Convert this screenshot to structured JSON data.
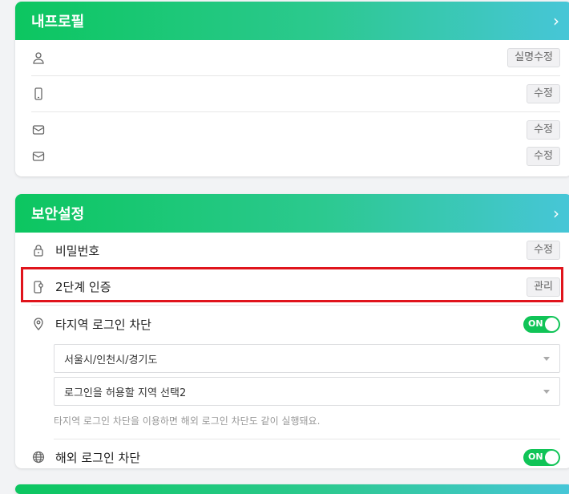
{
  "profile": {
    "title": "내프로필",
    "rows": [
      {
        "icon": "user-icon",
        "button": "실명수정"
      },
      {
        "icon": "phone-icon",
        "button": "수정"
      },
      {
        "icon": "mail-icon",
        "button": "수정"
      },
      {
        "icon": "mail-icon",
        "button": "수정"
      }
    ]
  },
  "security": {
    "title": "보안설정",
    "password": {
      "label": "비밀번호",
      "button": "수정"
    },
    "two_factor": {
      "label": "2단계 인증",
      "button": "관리"
    },
    "region_block": {
      "label": "타지역 로그인 차단",
      "toggle": "ON",
      "select1": "서울시/인천시/경기도",
      "select2": "로그인을 허용할 지역 선택2",
      "note": "타지역 로그인 차단을 이용하면 해외 로그인 차단도 같이 실행돼요."
    },
    "overseas_block": {
      "label": "해외 로그인 차단",
      "toggle": "ON"
    }
  },
  "colors": {
    "accent_green": "#10c457",
    "highlight_red": "#e0141c"
  }
}
